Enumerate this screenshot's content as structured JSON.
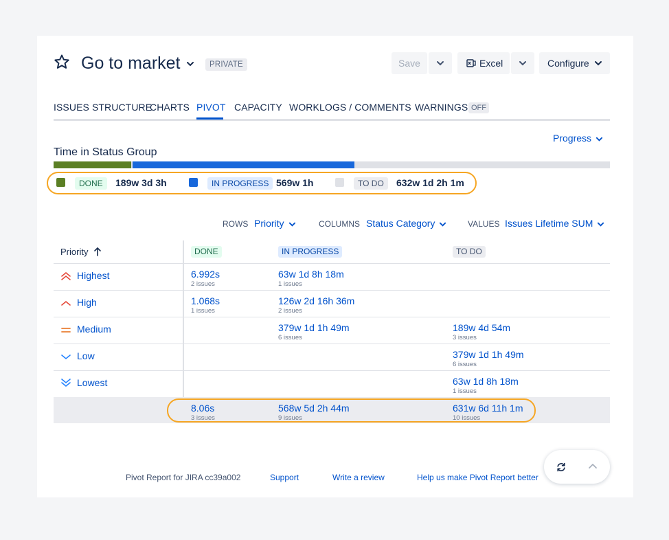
{
  "header": {
    "title": "Go to market",
    "visibility_badge": "PRIVATE",
    "save_label": "Save",
    "excel_label": "Excel",
    "configure_label": "Configure"
  },
  "tabs": [
    {
      "label": "ISSUES STRUCTURE",
      "active": false
    },
    {
      "label": "CHARTS",
      "active": false
    },
    {
      "label": "PIVOT",
      "active": true
    },
    {
      "label": "CAPACITY",
      "active": false
    },
    {
      "label": "WORKLOGS / COMMENTS",
      "active": false
    },
    {
      "label": "WARNINGS",
      "active": false,
      "badge": "OFF"
    }
  ],
  "summary": {
    "view_selector": "Progress",
    "title": "Time in Status Group",
    "bar": {
      "done_fraction": 0.1396,
      "in_progress_fraction": 0.4014,
      "to_do_fraction": 0.459
    },
    "legend": [
      {
        "label": "DONE",
        "value": "189w 3d 3h",
        "color": "#5b7f24"
      },
      {
        "label": "IN PROGRESS",
        "value": "569w 1h",
        "color": "#1868db"
      },
      {
        "label": "TO DO",
        "value": "632w 1d 2h 1m",
        "color": "#dfe1e6"
      }
    ]
  },
  "controls": {
    "rows_label": "ROWS",
    "rows_value": "Priority",
    "columns_label": "COLUMNS",
    "columns_value": "Status Category",
    "values_label": "VALUES",
    "values_value": "Issues Lifetime SUM"
  },
  "table": {
    "row_header": "Priority",
    "columns": [
      "DONE",
      "IN PROGRESS",
      "TO DO"
    ],
    "rows": [
      {
        "label": "Highest",
        "icon": "priority-highest-icon",
        "done": {
          "value": "6.992s",
          "count": "2 issues"
        },
        "in_progress": {
          "value": "63w 1d 8h 18m",
          "count": "1 issues"
        },
        "to_do": null
      },
      {
        "label": "High",
        "icon": "priority-high-icon",
        "done": {
          "value": "1.068s",
          "count": "1 issues"
        },
        "in_progress": {
          "value": "126w 2d 16h 36m",
          "count": "2 issues"
        },
        "to_do": null
      },
      {
        "label": "Medium",
        "icon": "priority-medium-icon",
        "done": null,
        "in_progress": {
          "value": "379w 1d 1h 49m",
          "count": "6 issues"
        },
        "to_do": {
          "value": "189w 4d 54m",
          "count": "3 issues"
        }
      },
      {
        "label": "Low",
        "icon": "priority-low-icon",
        "done": null,
        "in_progress": null,
        "to_do": {
          "value": "379w 1d 1h 49m",
          "count": "6 issues"
        }
      },
      {
        "label": "Lowest",
        "icon": "priority-lowest-icon",
        "done": null,
        "in_progress": null,
        "to_do": {
          "value": "63w 1d 8h 18m",
          "count": "1 issues"
        }
      }
    ],
    "totals": {
      "done": {
        "value": "8.06s",
        "count": "3 issues"
      },
      "in_progress": {
        "value": "568w 5d 2h 44m",
        "count": "9 issues"
      },
      "to_do": {
        "value": "631w 6d 11h 1m",
        "count": "10 issues"
      }
    }
  },
  "footer": {
    "version": "Pivot Report for JIRA cc39a002",
    "support": "Support",
    "review": "Write a review",
    "feedback": "Help us make Pivot Report better"
  },
  "colors": {
    "accent": "#0052cc",
    "done": "#5b7f24",
    "in_progress": "#1868db",
    "to_do": "#dfe1e6",
    "highlight_ring": "#f6a623"
  }
}
